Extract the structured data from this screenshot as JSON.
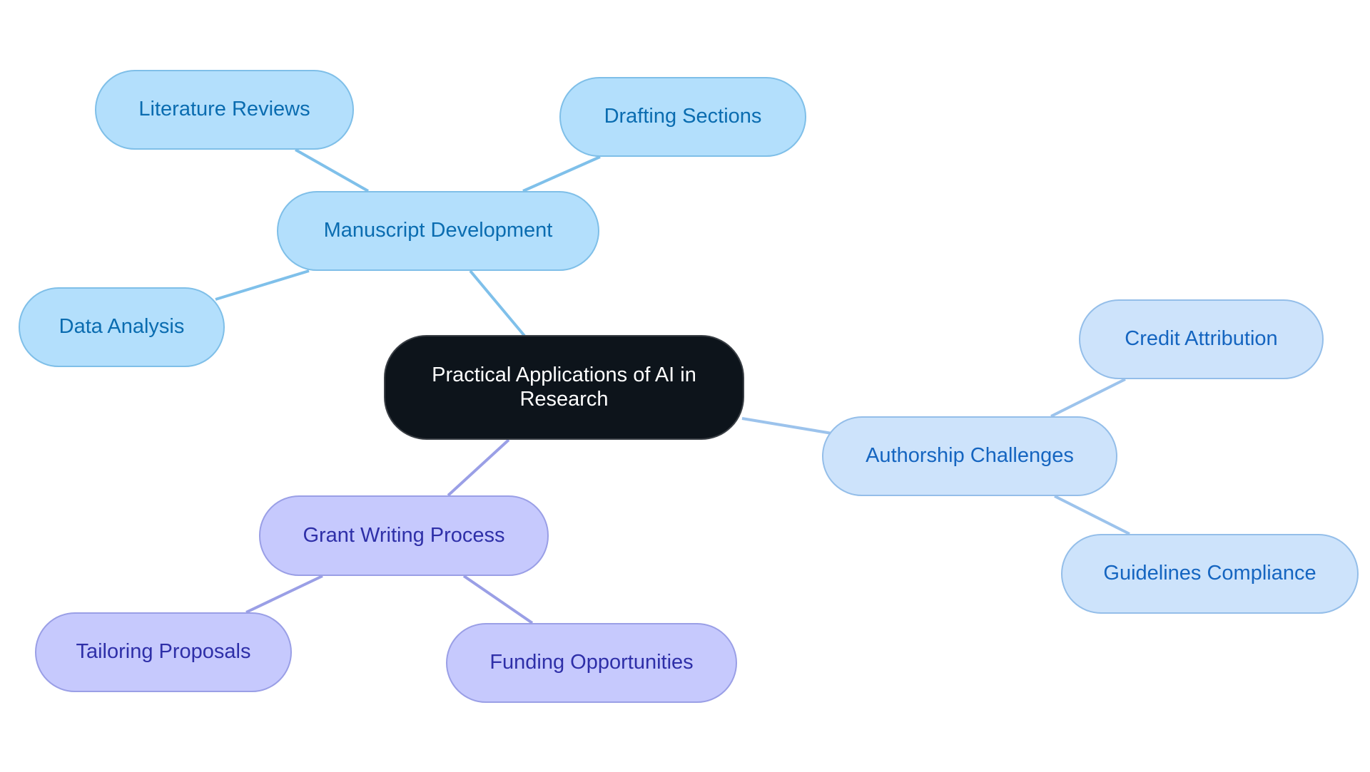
{
  "diagram": {
    "type": "mind-map",
    "root": {
      "id": "root",
      "label": "Practical Applications of AI in Research"
    },
    "branches": [
      {
        "id": "manuscript",
        "label": "Manuscript Development",
        "color": "#b3dffc",
        "text_color": "#0a6cb0",
        "edge_color": "#7fc0ea",
        "children": [
          {
            "id": "literature",
            "label": "Literature Reviews"
          },
          {
            "id": "drafting",
            "label": "Drafting Sections"
          },
          {
            "id": "data",
            "label": "Data Analysis"
          }
        ]
      },
      {
        "id": "authorship",
        "label": "Authorship Challenges",
        "color": "#cde3fb",
        "text_color": "#1565c0",
        "edge_color": "#9cc3ec",
        "children": [
          {
            "id": "credit",
            "label": "Credit Attribution"
          },
          {
            "id": "guidelines",
            "label": "Guidelines Compliance"
          }
        ]
      },
      {
        "id": "grant",
        "label": "Grant Writing Process",
        "color": "#c6c9fd",
        "text_color": "#2e2fa8",
        "edge_color": "#9a9fe6",
        "children": [
          {
            "id": "tailoring",
            "label": "Tailoring Proposals"
          },
          {
            "id": "funding",
            "label": "Funding Opportunities"
          }
        ]
      }
    ]
  }
}
